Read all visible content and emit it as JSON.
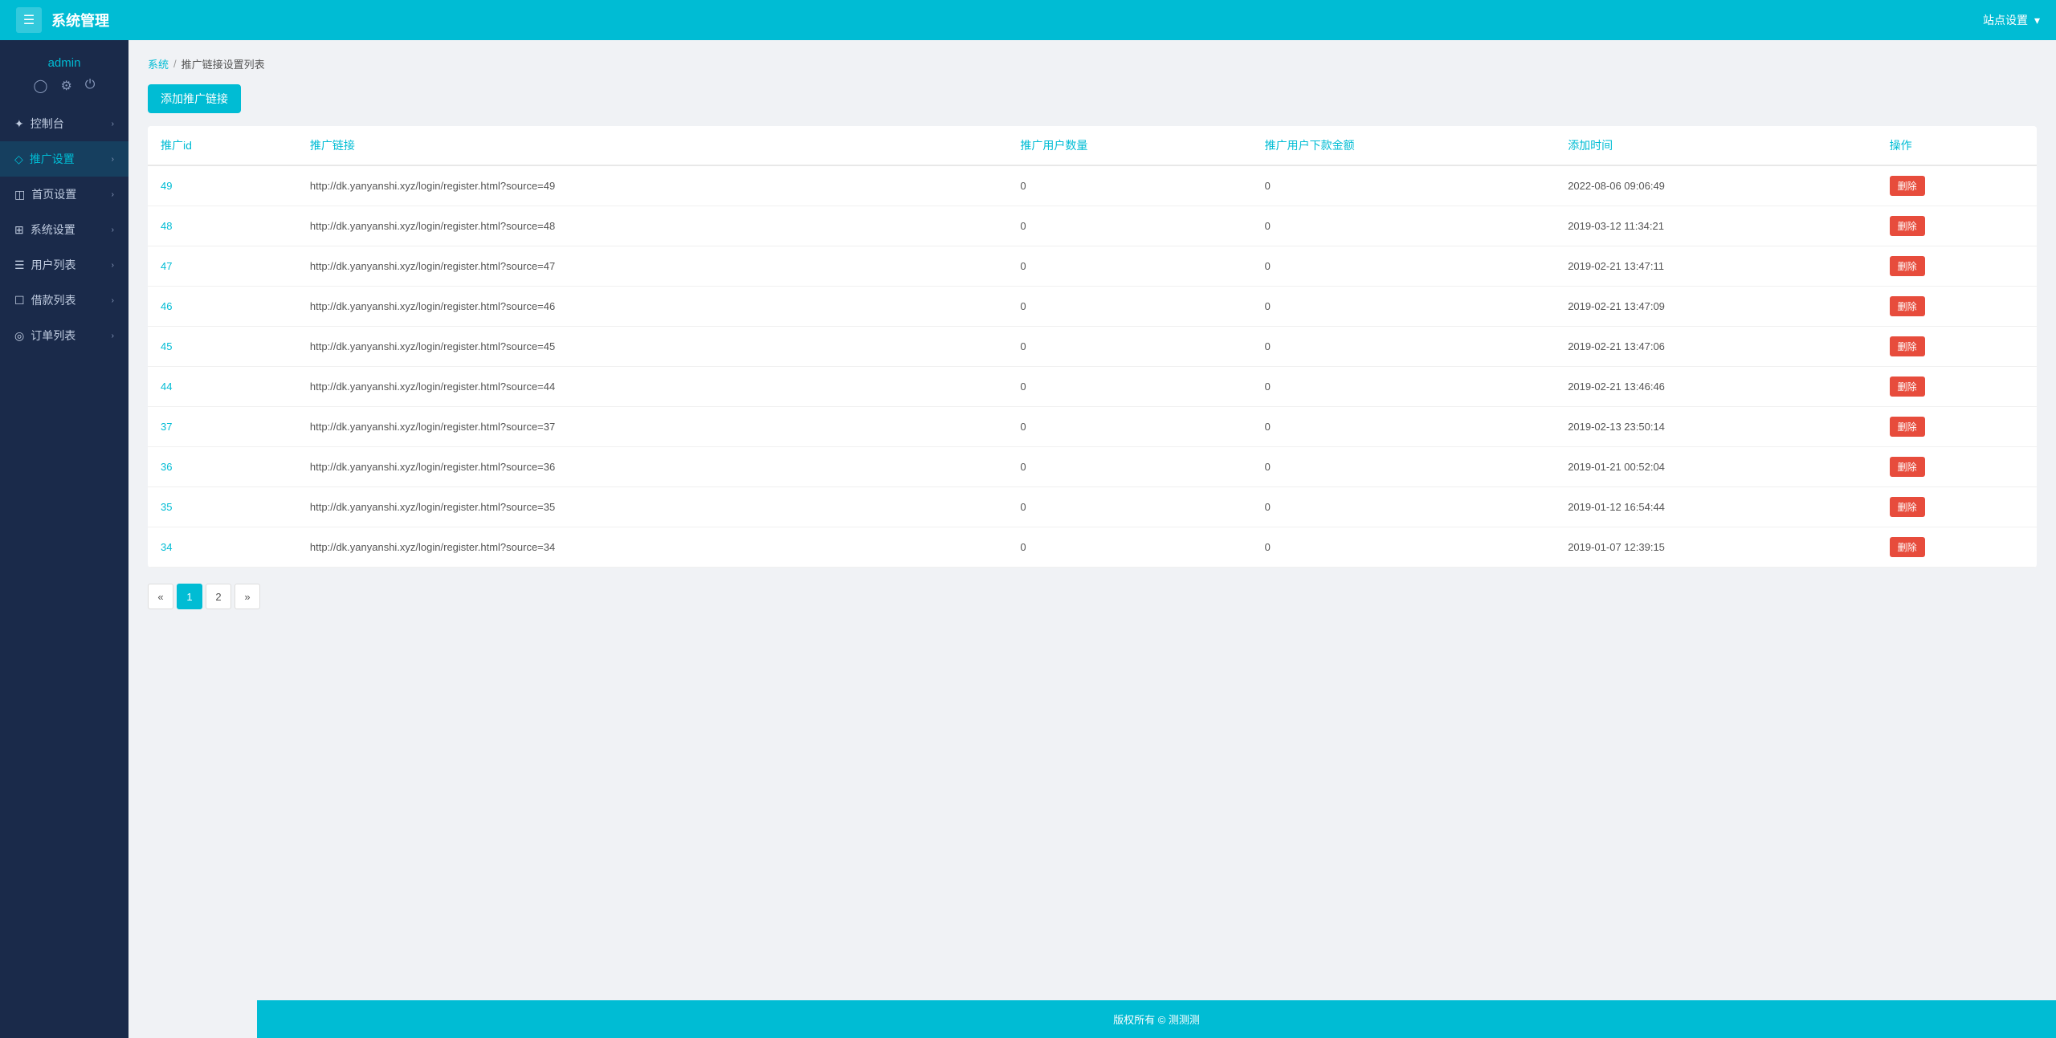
{
  "header": {
    "title": "系统管理",
    "menu_icon": "☰",
    "site_settings": "站点设置",
    "dropdown_icon": "▾"
  },
  "sidebar": {
    "user": {
      "name": "admin",
      "profile_icon": "👤",
      "settings_icon": "⚙",
      "logout_icon": "⏻"
    },
    "nav": [
      {
        "id": "dashboard",
        "icon": "◈",
        "label": "控制台",
        "arrow": "›"
      },
      {
        "id": "promo",
        "icon": "◇",
        "label": "推广设置",
        "arrow": "›"
      },
      {
        "id": "home",
        "icon": "⊟",
        "label": "首页设置",
        "arrow": "›"
      },
      {
        "id": "system",
        "icon": "⊞",
        "label": "系统设置",
        "arrow": "›"
      },
      {
        "id": "users",
        "icon": "☰",
        "label": "用户列表",
        "arrow": "›"
      },
      {
        "id": "loans",
        "icon": "☐",
        "label": "借款列表",
        "arrow": "›"
      },
      {
        "id": "orders",
        "icon": "◎",
        "label": "订单列表",
        "arrow": "›"
      }
    ]
  },
  "breadcrumb": {
    "home": "系统",
    "separator": "/",
    "current": "推广链接设置列表"
  },
  "add_button": "添加推广链接",
  "table": {
    "headers": [
      "推广id",
      "推广链接",
      "推广用户数量",
      "推广用户下款金额",
      "添加时间",
      "操作"
    ],
    "delete_label": "删除",
    "rows": [
      {
        "id": "49",
        "link": "http://dk.yanyanshi.xyz/login/register.html?source=49",
        "users": "0",
        "amount": "0",
        "time": "2022-08-06 09:06:49"
      },
      {
        "id": "48",
        "link": "http://dk.yanyanshi.xyz/login/register.html?source=48",
        "users": "0",
        "amount": "0",
        "time": "2019-03-12 11:34:21"
      },
      {
        "id": "47",
        "link": "http://dk.yanyanshi.xyz/login/register.html?source=47",
        "users": "0",
        "amount": "0",
        "time": "2019-02-21 13:47:11"
      },
      {
        "id": "46",
        "link": "http://dk.yanyanshi.xyz/login/register.html?source=46",
        "users": "0",
        "amount": "0",
        "time": "2019-02-21 13:47:09"
      },
      {
        "id": "45",
        "link": "http://dk.yanyanshi.xyz/login/register.html?source=45",
        "users": "0",
        "amount": "0",
        "time": "2019-02-21 13:47:06"
      },
      {
        "id": "44",
        "link": "http://dk.yanyanshi.xyz/login/register.html?source=44",
        "users": "0",
        "amount": "0",
        "time": "2019-02-21 13:46:46"
      },
      {
        "id": "37",
        "link": "http://dk.yanyanshi.xyz/login/register.html?source=37",
        "users": "0",
        "amount": "0",
        "time": "2019-02-13 23:50:14"
      },
      {
        "id": "36",
        "link": "http://dk.yanyanshi.xyz/login/register.html?source=36",
        "users": "0",
        "amount": "0",
        "time": "2019-01-21 00:52:04"
      },
      {
        "id": "35",
        "link": "http://dk.yanyanshi.xyz/login/register.html?source=35",
        "users": "0",
        "amount": "0",
        "time": "2019-01-12 16:54:44"
      },
      {
        "id": "34",
        "link": "http://dk.yanyanshi.xyz/login/register.html?source=34",
        "users": "0",
        "amount": "0",
        "time": "2019-01-07 12:39:15"
      }
    ]
  },
  "pagination": {
    "prev": "«",
    "pages": [
      "1",
      "2"
    ],
    "next": "»",
    "active": "1"
  },
  "footer": {
    "text": "版权所有 © 测测测"
  }
}
